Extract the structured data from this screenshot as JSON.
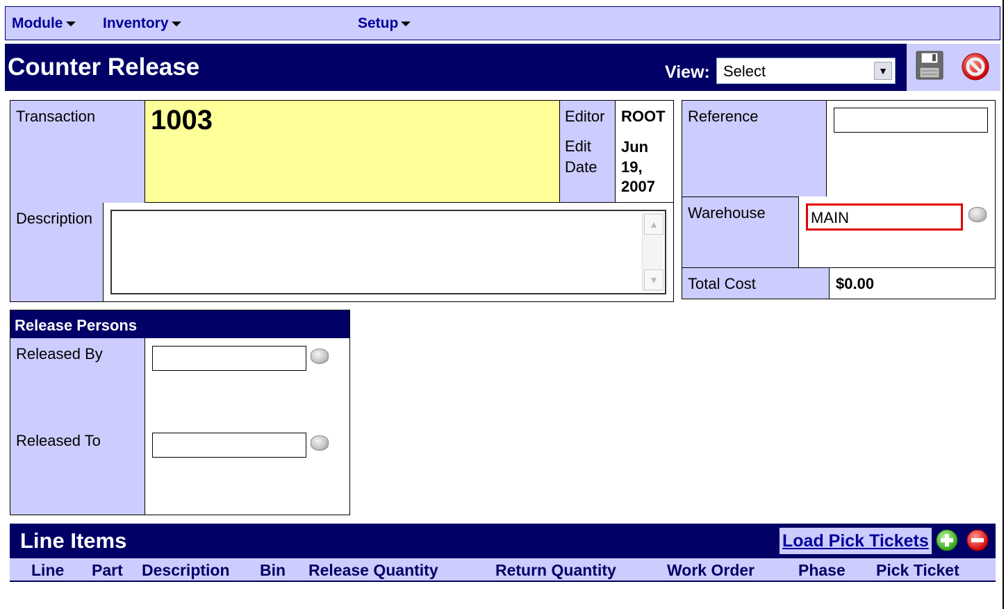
{
  "menu": {
    "module": "Module",
    "inventory": "Inventory",
    "setup": "Setup"
  },
  "header": {
    "title": "Counter Release",
    "view_label": "View:",
    "view_selected": "Select"
  },
  "transaction": {
    "label": "Transaction",
    "value": "1003",
    "editor_label": "Editor",
    "editor_value": "ROOT",
    "edit_date_label_1": "Edit",
    "edit_date_label_2": "Date",
    "edit_date_value_1": "Jun",
    "edit_date_value_2": "19,",
    "edit_date_value_3": "2007",
    "description_label": "Description",
    "description_value": ""
  },
  "details": {
    "reference_label": "Reference",
    "reference_value": "",
    "warehouse_label": "Warehouse",
    "warehouse_value": "MAIN",
    "total_cost_label": "Total Cost",
    "total_cost_value": "$0.00"
  },
  "release_persons": {
    "title": "Release Persons",
    "released_by_label": "Released By",
    "released_by_value": "",
    "released_to_label": "Released To",
    "released_to_value": ""
  },
  "line_items": {
    "title": "Line Items",
    "load_pick_tickets": "Load Pick Tickets",
    "columns": [
      "Line",
      "Part",
      "Description",
      "Bin",
      "Release Quantity",
      "Return Quantity",
      "Work Order",
      "Phase",
      "Pick Ticket"
    ]
  },
  "colors": {
    "navy": "#000066",
    "lavender": "#ccccff",
    "highlight_yellow": "#ffff99",
    "required_red": "#e00000"
  },
  "icons": [
    "save-icon",
    "cancel-icon",
    "lookup-icon",
    "add-icon",
    "remove-icon",
    "dropdown-arrow-icon"
  ]
}
